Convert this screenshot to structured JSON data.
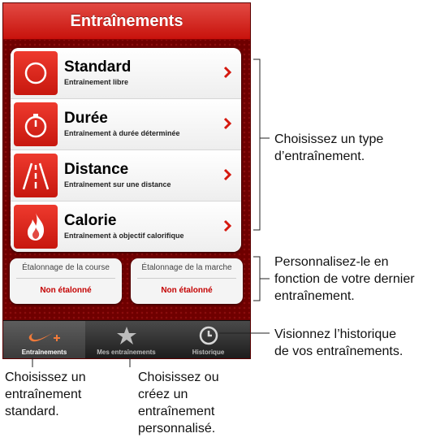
{
  "header": {
    "title": "Entraînements"
  },
  "workouts": [
    {
      "title": "Standard",
      "subtitle": "Entraînement libre",
      "icon": "circle-icon"
    },
    {
      "title": "Durée",
      "subtitle": "Entraînement à durée déterminée",
      "icon": "stopwatch-icon"
    },
    {
      "title": "Distance",
      "subtitle": "Entraînement sur une distance",
      "icon": "road-icon"
    },
    {
      "title": "Calorie",
      "subtitle": "Entraînement à objectif calorifique",
      "icon": "flame-icon"
    }
  ],
  "calibration": {
    "run": {
      "label": "Étalonnage de la course",
      "value": "Non étalonné"
    },
    "walk": {
      "label": "Étalonnage de la marche",
      "value": "Non étalonné"
    }
  },
  "tabs": [
    {
      "label": "Entraînements",
      "icon": "swoosh-plus-icon",
      "active": true
    },
    {
      "label": "Mes entraînements",
      "icon": "star-icon",
      "active": false
    },
    {
      "label": "Historique",
      "icon": "clock-icon",
      "active": false
    }
  ],
  "callouts": {
    "type": [
      "Choisissez un type",
      "d’entraînement."
    ],
    "calibration": [
      "Personnalisez-le en",
      "fonction de votre dernier",
      "entraînement."
    ],
    "history": [
      "Visionnez l’historique",
      "de vos entraînements."
    ],
    "standard": [
      "Choisissez un",
      "entraînement",
      "standard."
    ],
    "custom": [
      "Choisissez ou",
      "créez un",
      "entraînement",
      "personnalisé."
    ]
  },
  "colors": {
    "accent": "#d5190f",
    "background": "#6f0000",
    "value_text": "#c40000"
  }
}
